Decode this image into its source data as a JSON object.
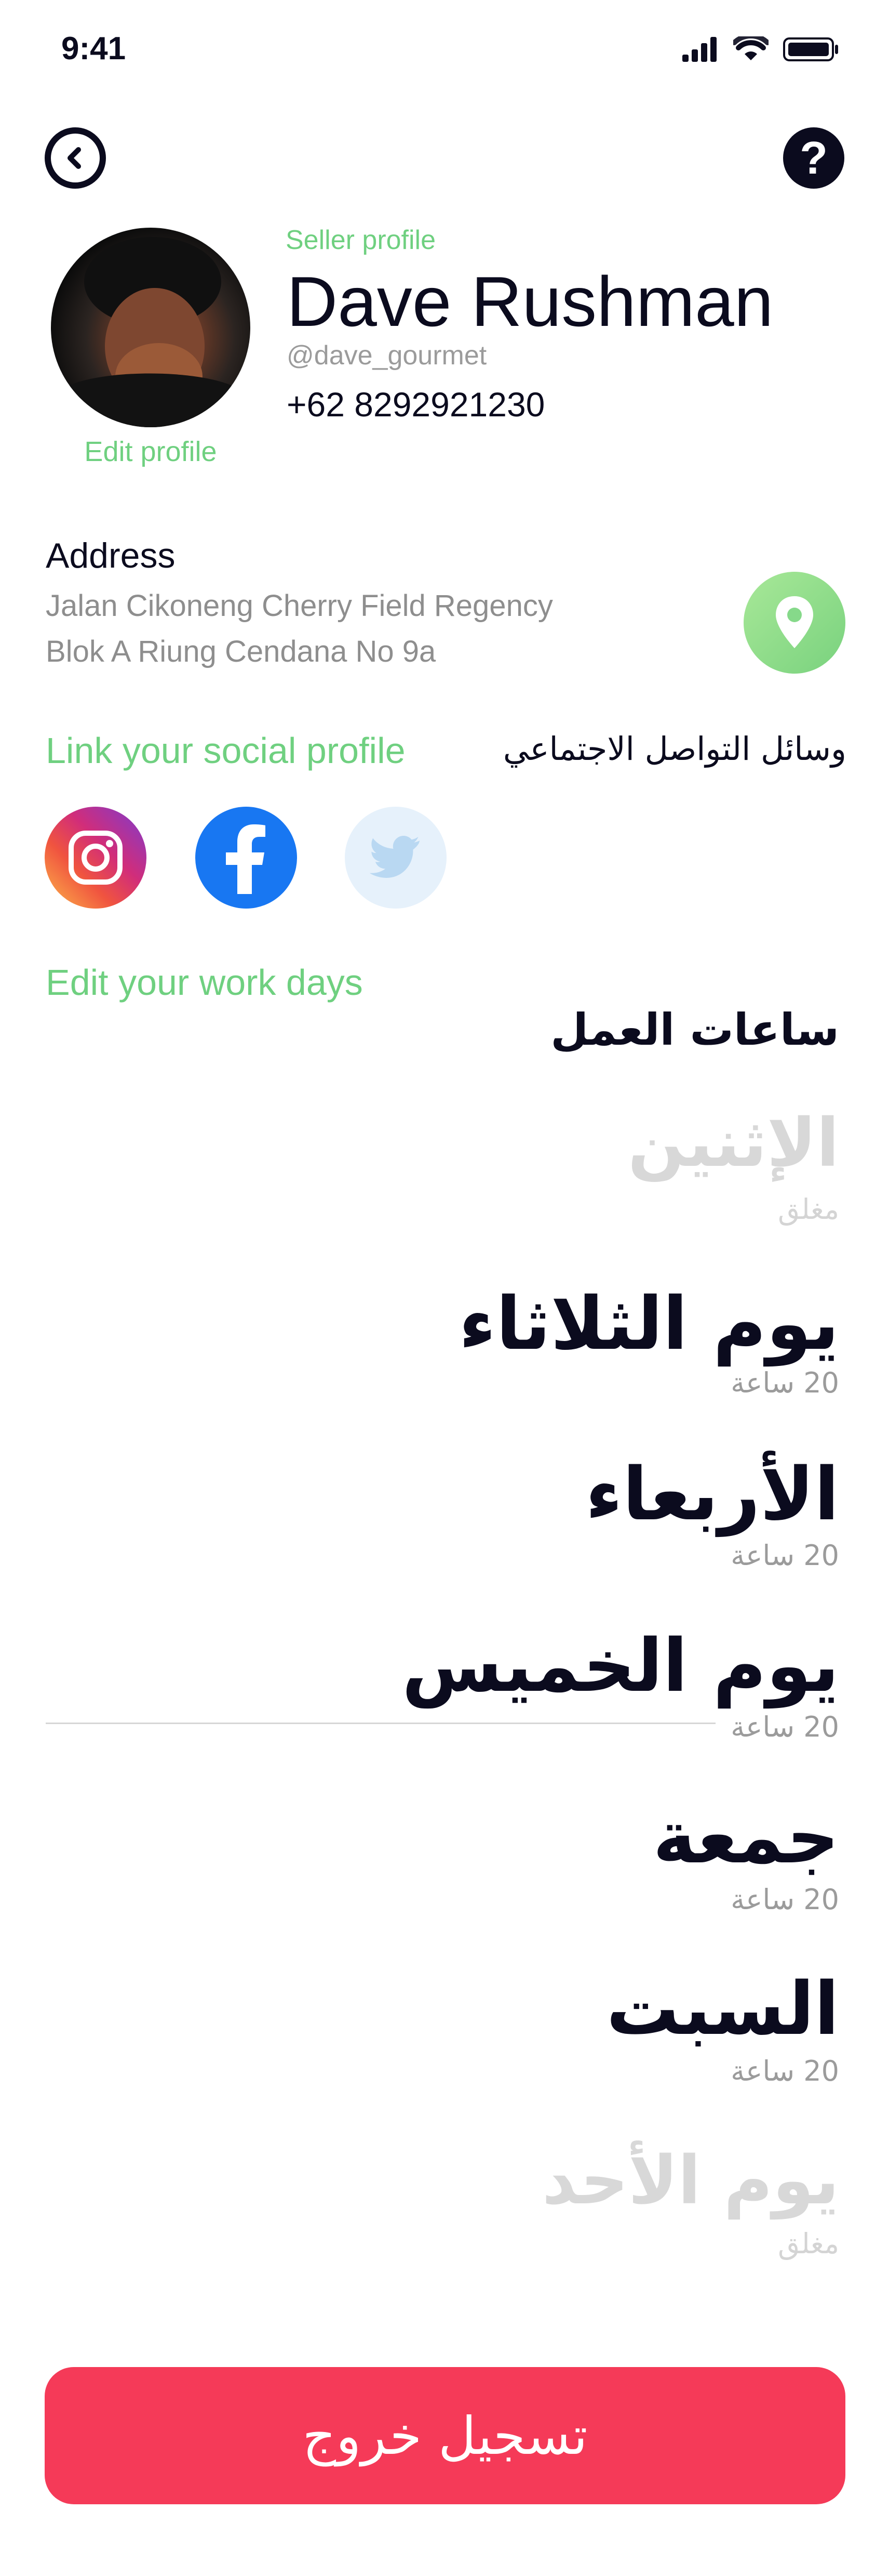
{
  "status_bar": {
    "time": "9:41"
  },
  "header": {
    "back_icon": "back-chevron-icon",
    "help_icon": "help-icon",
    "help_label": "?"
  },
  "profile": {
    "seller_label": "Seller profile",
    "name": "Dave Rushman",
    "handle": "@dave_gourmet",
    "phone": "+62 8292921230",
    "edit_label": "Edit profile"
  },
  "address": {
    "label": "Address",
    "line1": "Jalan Cikoneng Cherry Field Regency",
    "line2": "Blok A Riung Cendana No 9a",
    "icon": "location-pin-icon"
  },
  "social": {
    "link_label": "Link your social profile",
    "arabic_label": "وسائل التواصل الاجتماعي",
    "icons": [
      "instagram-icon",
      "facebook-icon",
      "twitter-icon"
    ]
  },
  "workdays": {
    "edit_label": "Edit your work days",
    "title": "ساعات العمل",
    "days": [
      {
        "name": "الإثنين",
        "hours": "مغلق",
        "state": "closed"
      },
      {
        "name": "يوم الثلاثاء",
        "hours": "20 ساعة",
        "state": "open"
      },
      {
        "name": "الأربعاء",
        "hours": "20 ساعة",
        "state": "open"
      },
      {
        "name": "يوم الخميس",
        "hours": "20 ساعة",
        "state": "open"
      },
      {
        "name": "جمعة",
        "hours": "20 ساعة",
        "state": "open"
      },
      {
        "name": "السبت",
        "hours": "20 ساعة",
        "state": "open"
      },
      {
        "name": "يوم الأحد",
        "hours": "مغلق",
        "state": "closed"
      }
    ]
  },
  "actions": {
    "logout_label": "تسجيل خروج"
  },
  "colors": {
    "accent_green": "#6fd080",
    "danger_red": "#f53a58",
    "text_dark": "#0b0b1e",
    "muted_gray": "#9b9b9b"
  }
}
